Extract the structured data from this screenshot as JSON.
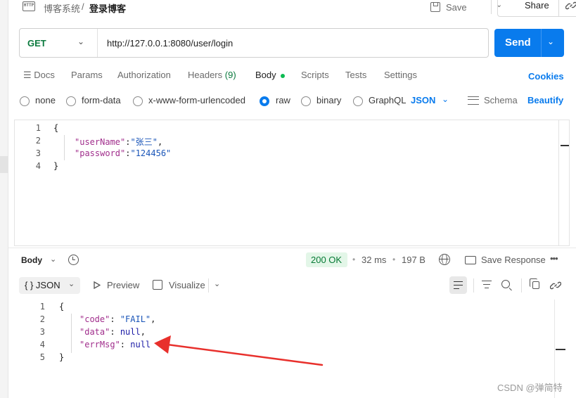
{
  "header": {
    "icon_text": "HTTP",
    "breadcrumb_parent": "博客系统",
    "breadcrumb_separator": "/",
    "breadcrumb_current": "登录博客",
    "save_label": "Save",
    "share_label": "Share"
  },
  "request": {
    "method": "GET",
    "url": "http://127.0.0.1:8080/user/login",
    "send_label": "Send"
  },
  "tabs": [
    {
      "label": "Docs"
    },
    {
      "label": "Params"
    },
    {
      "label": "Authorization"
    },
    {
      "label": "Headers",
      "count": "(9)"
    },
    {
      "label": "Body"
    },
    {
      "label": "Scripts"
    },
    {
      "label": "Tests"
    },
    {
      "label": "Settings"
    }
  ],
  "cookies_label": "Cookies",
  "body_types": [
    "none",
    "form-data",
    "x-www-form-urlencoded",
    "raw",
    "binary",
    "GraphQL"
  ],
  "body_type_selected": "raw",
  "body_format": "JSON",
  "schema_label": "Schema",
  "beautify_label": "Beautify",
  "request_body_lines": [
    {
      "num": "1",
      "text": "{"
    },
    {
      "num": "2",
      "key": "\"userName\"",
      "value": "\"张三\"",
      "tail": ","
    },
    {
      "num": "3",
      "key": "\"password\"",
      "value": "\"124456\"",
      "tail": ""
    },
    {
      "num": "4",
      "text": "}"
    }
  ],
  "response": {
    "body_label": "Body",
    "status": "200 OK",
    "time": "32 ms",
    "size": "197 B",
    "save_response_label": "Save Response",
    "format_label": "JSON",
    "format_icon": "{ }",
    "preview_label": "Preview",
    "visualize_label": "Visualize",
    "lines": [
      {
        "num": "1",
        "text": "{"
      },
      {
        "num": "2",
        "key": "\"code\"",
        "value": "\"FAIL\"",
        "tail": ","
      },
      {
        "num": "3",
        "key": "\"data\"",
        "value": "null",
        "tail": ","
      },
      {
        "num": "4",
        "key": "\"errMsg\"",
        "value": "null",
        "tail": ""
      },
      {
        "num": "5",
        "text": "}"
      }
    ]
  },
  "watermark": "CSDN @弹简特",
  "colors": {
    "accent": "#097bed",
    "method_green": "#0b7a3e",
    "status_green": "#067a35",
    "annotation_arrow": "#e8302c"
  }
}
